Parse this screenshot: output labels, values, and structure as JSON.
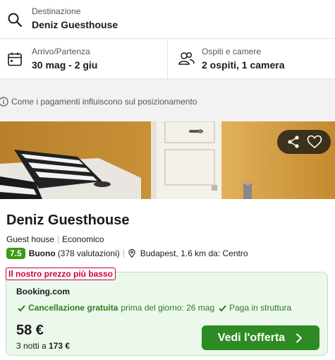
{
  "search": {
    "destination_label": "Destinazione",
    "destination_value": "Deniz Guesthouse",
    "dates_label": "Arrivo/Partenza",
    "dates_value": "30 mag - 2 giu",
    "guests_label": "Ospiti e camere",
    "guests_value": "2 ospiti, 1 camera"
  },
  "info": {
    "ranking_note": "Come i pagamenti influiscono sul posizionamento"
  },
  "photo": {
    "actions": [
      "share-icon",
      "heart-icon"
    ]
  },
  "hotel": {
    "name": "Deniz Guesthouse",
    "type": "Guest house",
    "category": "Economico",
    "rating_score": "7.5",
    "rating_word": "Buono",
    "rating_count": "(378 valutazioni)",
    "location": "Budapest, 1.6 km da: Centro"
  },
  "offer": {
    "badge": "Il nostro prezzo più basso",
    "provider": "Booking.com",
    "perk1_bold": "Cancellazione gratuita",
    "perk1_rest": "prima del giorno: 26 mag",
    "perk2": "Paga in struttura",
    "price": "58 €",
    "nights_prefix": "3 notti a",
    "nights_total": "173 €",
    "cta_label": "Vedi l'offerta"
  },
  "colors": {
    "accent_green": "#2e8b23",
    "rating_green": "#3a9b17",
    "badge_red": "#c8003c",
    "offer_bg": "#ebf8eb"
  }
}
